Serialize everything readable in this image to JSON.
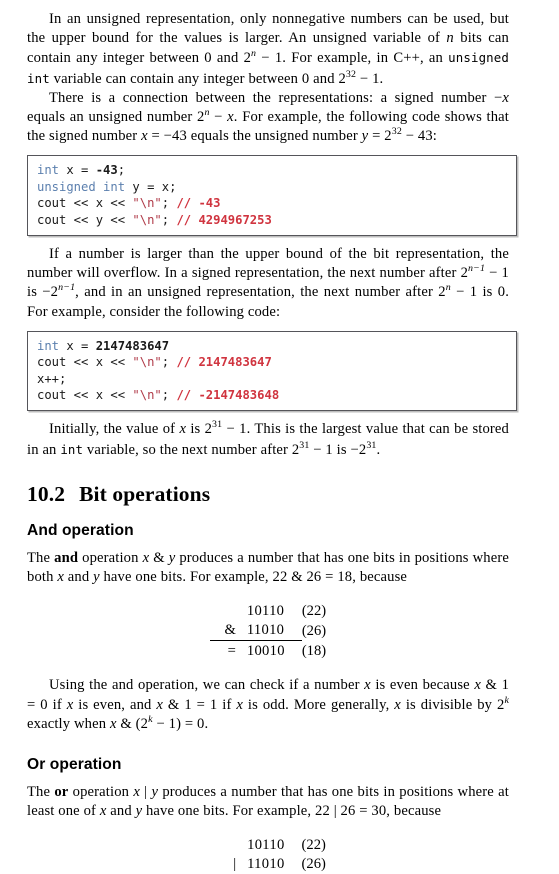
{
  "document": {
    "type": "textbook-page",
    "topic": "Bit manipulation"
  },
  "paragraphs": {
    "p1_a": "In an unsigned representation, only nonnegative numbers can be used, but the upper bound for the values is larger. An unsigned variable of ",
    "p1_n": "n",
    "p1_b": " bits can contain any integer between 0 and 2",
    "p1_sup1": "n",
    "p1_c": " − 1. For example, in C++, an ",
    "p1_mono": "unsigned int",
    "p1_d": " variable can contain any integer between 0 and 2",
    "p1_sup2": "32",
    "p1_e": " − 1.",
    "p2_a": "There is a connection between the representations: a signed number −",
    "p2_x1": "x",
    "p2_b": " equals an unsigned number 2",
    "p2_sup1": "n",
    "p2_c": " − ",
    "p2_x2": "x",
    "p2_d": ". For example, the following code shows that the signed number ",
    "p2_x3": "x",
    "p2_e": " = −43 equals the unsigned number ",
    "p2_y": "y",
    "p2_f": " = 2",
    "p2_sup2": "32",
    "p2_g": " − 43:",
    "p3_a": "If a number is larger than the upper bound of the bit representation, the number will overflow. In a signed representation, the next number after 2",
    "p3_sup1": "n−1",
    "p3_b": " − 1 is −2",
    "p3_sup2": "n−1",
    "p3_c": ", and in an unsigned representation, the next number after 2",
    "p3_sup3": "n",
    "p3_d": " − 1 is 0. For example, consider the following code:",
    "p4_a": "Initially, the value of ",
    "p4_x": "x",
    "p4_b": " is 2",
    "p4_sup1": "31",
    "p4_c": " − 1. This is the largest value that can be stored in an ",
    "p4_mono": "int",
    "p4_d": " variable, so the next number after 2",
    "p4_sup2": "31",
    "p4_e": " − 1 is −2",
    "p4_sup3": "31",
    "p4_f": ".",
    "p5_a": "The ",
    "p5_and": "and",
    "p5_b": " operation ",
    "p5_x": "x",
    "p5_amp": " & ",
    "p5_y": "y",
    "p5_c": " produces a number that has one bits in positions where both ",
    "p5_x2": "x",
    "p5_d": " and ",
    "p5_y2": "y",
    "p5_e": " have one bits. For example, 22 & 26 = 18, because",
    "p6_a": "Using the and operation, we can check if a number ",
    "p6_x1": "x",
    "p6_b": " is even because ",
    "p6_x2": "x",
    "p6_c": " & 1 = 0 if ",
    "p6_x3": "x",
    "p6_d": " is even, and ",
    "p6_x4": "x",
    "p6_e": " & 1 = 1 if ",
    "p6_x5": "x",
    "p6_f": " is odd. More generally, ",
    "p6_x6": "x",
    "p6_g": " is divisible by 2",
    "p6_sup1": "k",
    "p6_h": " exactly when ",
    "p6_x7": "x",
    "p6_i": " & (2",
    "p6_sup2": "k",
    "p6_j": " − 1) = 0.",
    "p7_a": "The ",
    "p7_or": "or",
    "p7_b": " operation ",
    "p7_x": "x",
    "p7_pipe": " | ",
    "p7_y": "y",
    "p7_c": " produces a number that has one bits in positions where at least one of ",
    "p7_x2": "x",
    "p7_d": " and ",
    "p7_y2": "y",
    "p7_e": " have one bits. For example, 22 | 26 = 30, because"
  },
  "headings": {
    "section_number": "10.2",
    "section_title": "Bit operations",
    "sub_and": "And operation",
    "sub_or": "Or operation"
  },
  "code_blocks": [
    {
      "id": "code-signed-unsigned",
      "lines": [
        [
          {
            "t": "int",
            "c": "kw"
          },
          {
            "t": " x = ",
            "c": "plain"
          },
          {
            "t": "-43",
            "c": "numlit"
          },
          {
            "t": ";",
            "c": "plain"
          }
        ],
        [
          {
            "t": "unsigned int",
            "c": "kw"
          },
          {
            "t": " y = x;",
            "c": "plain"
          }
        ],
        [
          {
            "t": "cout << x << ",
            "c": "plain"
          },
          {
            "t": "\"\\n\"",
            "c": "str"
          },
          {
            "t": "; ",
            "c": "plain"
          },
          {
            "t": "// -43",
            "c": "cmt"
          }
        ],
        [
          {
            "t": "cout << y << ",
            "c": "plain"
          },
          {
            "t": "\"\\n\"",
            "c": "str"
          },
          {
            "t": "; ",
            "c": "plain"
          },
          {
            "t": "// 4294967253",
            "c": "cmt"
          }
        ]
      ]
    },
    {
      "id": "code-overflow",
      "lines": [
        [
          {
            "t": "int",
            "c": "kw"
          },
          {
            "t": " x = ",
            "c": "plain"
          },
          {
            "t": "2147483647",
            "c": "numlit"
          }
        ],
        [
          {
            "t": "cout << x << ",
            "c": "plain"
          },
          {
            "t": "\"\\n\"",
            "c": "str"
          },
          {
            "t": "; ",
            "c": "plain"
          },
          {
            "t": "// 2147483647",
            "c": "cmt"
          }
        ],
        [
          {
            "t": "x++;",
            "c": "plain"
          }
        ],
        [
          {
            "t": "cout << x << ",
            "c": "plain"
          },
          {
            "t": "\"\\n\"",
            "c": "str"
          },
          {
            "t": "; ",
            "c": "plain"
          },
          {
            "t": "// -2147483648",
            "c": "cmt"
          }
        ]
      ]
    }
  ],
  "bit_tables": [
    {
      "id": "and-table",
      "rows": [
        {
          "op": "",
          "bits": "10110",
          "dec": "(22)",
          "rule": false
        },
        {
          "op": "&",
          "bits": "11010",
          "dec": "(26)",
          "rule": false
        },
        {
          "op": "=",
          "bits": "10010",
          "dec": "(18)",
          "rule": true
        }
      ]
    },
    {
      "id": "or-table",
      "rows": [
        {
          "op": "",
          "bits": "10110",
          "dec": "(22)",
          "rule": false
        },
        {
          "op": "|",
          "bits": "11010",
          "dec": "(26)",
          "rule": false
        }
      ]
    }
  ],
  "colors": {
    "keyword": "#5b7fae",
    "string": "#b03a48",
    "comment": "#d0343f",
    "text": "#000000",
    "code_border": "#55555a"
  }
}
